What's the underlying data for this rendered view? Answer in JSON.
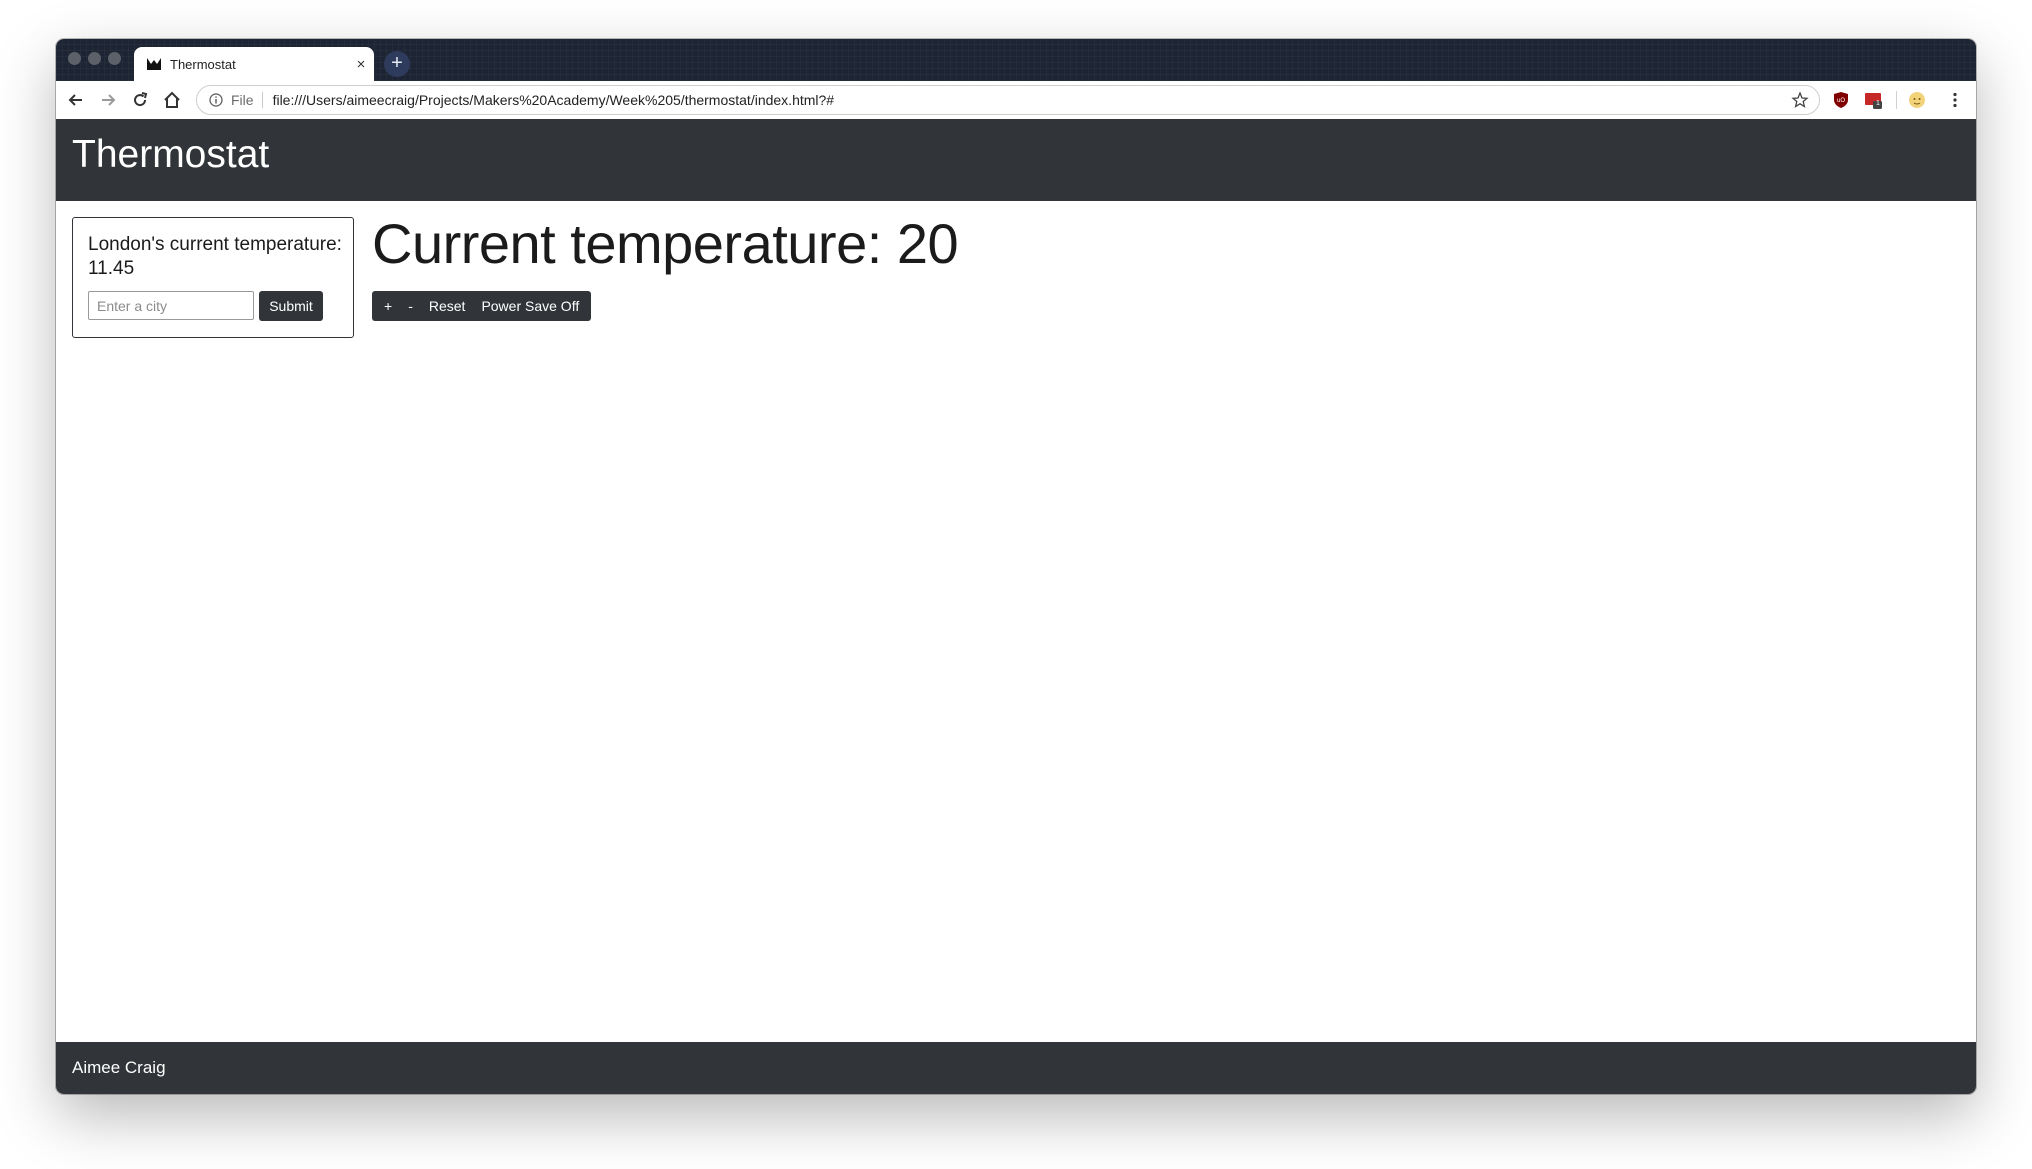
{
  "browser": {
    "tab_title": "Thermostat",
    "tab_close": "×",
    "new_tab": "+",
    "scheme_label": "File",
    "url": "file:///Users/aimeecraig/Projects/Makers%20Academy/Week%205/thermostat/index.html?#",
    "extension_badge": "1"
  },
  "header": {
    "title": "Thermostat"
  },
  "weather": {
    "text": "London's current temperature: 11.45",
    "city_placeholder": "Enter a city",
    "submit_label": "Submit"
  },
  "thermostat": {
    "temperature_text": "Current temperature: 20",
    "buttons": {
      "up": "+",
      "down": "-",
      "reset": "Reset",
      "power_save": "Power Save Off"
    }
  },
  "footer": {
    "author": "Aimee Craig"
  },
  "colors": {
    "dark": "#31353a",
    "tabstrip": "#1d2433"
  }
}
